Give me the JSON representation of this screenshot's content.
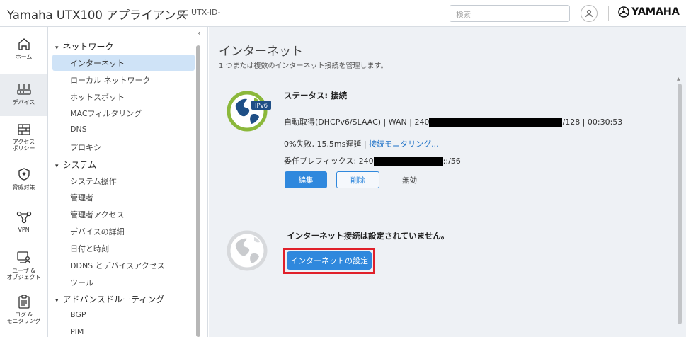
{
  "header": {
    "title": "Yamaha UTX100 アプライアンス",
    "device_id": "UTX-ID-",
    "search_placeholder": "検索",
    "brand": "YAMAHA"
  },
  "rail": {
    "items": [
      {
        "label": "ホーム"
      },
      {
        "label": "デバイス"
      },
      {
        "label": "アクセス\nポリシー"
      },
      {
        "label": "脅威対策"
      },
      {
        "label": "VPN"
      },
      {
        "label": "ユーザ &\nオブジェクト"
      },
      {
        "label": "ログ &\nモニタリング"
      }
    ]
  },
  "menu": {
    "groups": [
      {
        "label": "ネットワーク"
      },
      {
        "label": "システム"
      },
      {
        "label": "アドバンスドルーティング"
      }
    ],
    "items": [
      {
        "label": "インターネット"
      },
      {
        "label": "ローカル ネットワーク"
      },
      {
        "label": "ホットスポット"
      },
      {
        "label": "MACフィルタリング"
      },
      {
        "label": "DNS"
      },
      {
        "label": "プロキシ"
      },
      {
        "label": "システム操作"
      },
      {
        "label": "管理者"
      },
      {
        "label": "管理者アクセス"
      },
      {
        "label": "デバイスの詳細"
      },
      {
        "label": "日付と時刻"
      },
      {
        "label": "DDNS とデバイスアクセス"
      },
      {
        "label": "ツール"
      },
      {
        "label": "BGP"
      },
      {
        "label": "PIM"
      }
    ]
  },
  "main": {
    "title": "インターネット",
    "description": "1 つまたは複数のインターネット接続を管理します。",
    "connection": {
      "badge": "IPv6",
      "status": "ステータス: 接続",
      "detail_prefix": "自動取得(DHCPv6/SLAAC) | WAN | 240",
      "detail_suffix": "/128 | 00:30:53",
      "stats": "0%失敗, 15.5ms遅延 |",
      "monitor_link": "接続モニタリング...",
      "prefix_label": "委任プレフィックス: 240",
      "prefix_suffix": "::/56",
      "edit_label": "編集",
      "delete_label": "削除",
      "disabled_label": "無効"
    },
    "empty": {
      "message": "インターネット接続は設定されていません。",
      "setup_label": "インターネットの設定"
    }
  },
  "colors": {
    "accent": "#2f88dd",
    "highlight": "#e0202a",
    "globe_green": "#8bb83b",
    "globe_blue": "#1f4f86"
  }
}
